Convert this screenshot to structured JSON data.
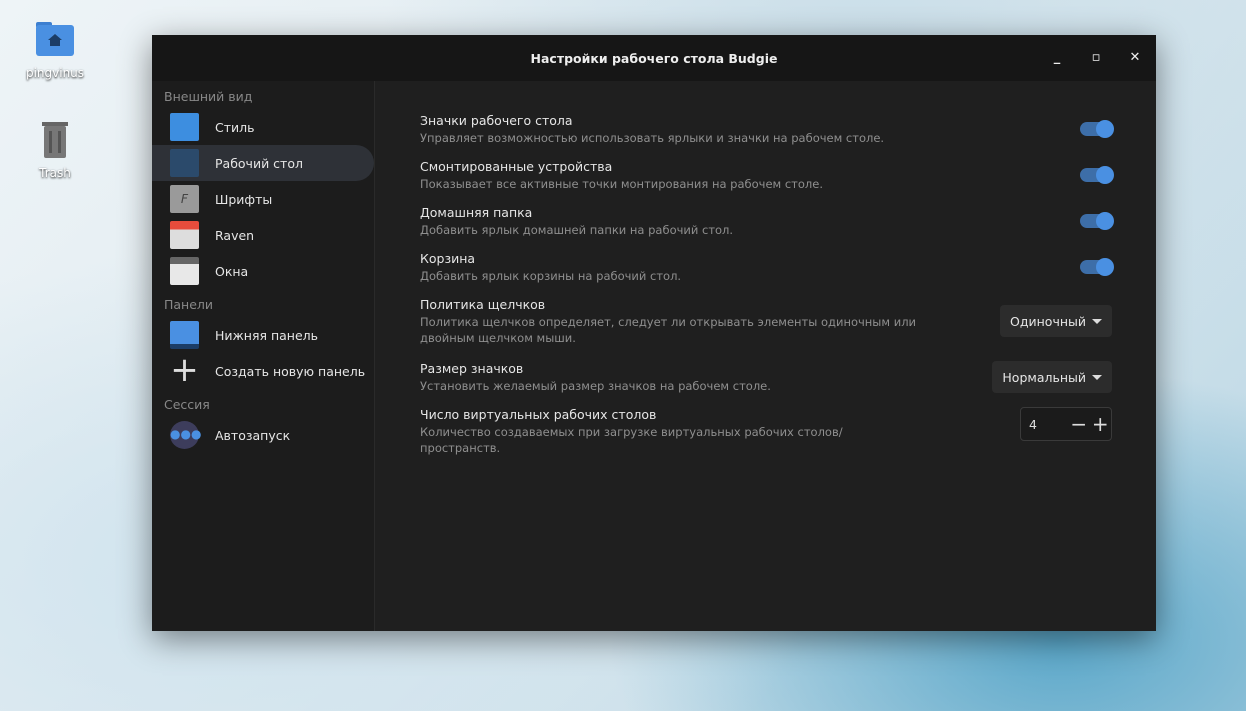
{
  "desktop": {
    "icons": [
      {
        "label": "pingvinus",
        "icon": "home-folder-icon"
      },
      {
        "label": "Trash",
        "icon": "trash-icon"
      }
    ]
  },
  "window": {
    "title": "Настройки рабочего стола Budgie"
  },
  "sidebar": {
    "sections": [
      {
        "title": "Внешний вид",
        "items": [
          {
            "label": "Стиль",
            "icon": "style-icon"
          },
          {
            "label": "Рабочий стол",
            "icon": "desktop-icon",
            "selected": true
          },
          {
            "label": "Шрифты",
            "icon": "fonts-icon"
          },
          {
            "label": "Raven",
            "icon": "calendar-icon"
          },
          {
            "label": "Окна",
            "icon": "windows-icon"
          }
        ]
      },
      {
        "title": "Панели",
        "items": [
          {
            "label": "Нижняя панель",
            "icon": "panel-icon"
          },
          {
            "label": "Создать новую панель",
            "icon": "plus-icon"
          }
        ]
      },
      {
        "title": "Сессия",
        "items": [
          {
            "label": "Автозапуск",
            "icon": "autostart-icon"
          }
        ]
      }
    ]
  },
  "settings": [
    {
      "title": "Значки рабочего стола",
      "desc": "Управляет возможностью использовать ярлыки и значки на рабочем столе.",
      "toggle": true
    },
    {
      "title": "Смонтированные устройства",
      "desc": "Показывает все активные точки монтирования на рабочем столе.",
      "toggle": true
    },
    {
      "title": "Домашняя папка",
      "desc": "Добавить ярлык домашней папки на рабочий стол.",
      "toggle": true
    },
    {
      "title": "Корзина",
      "desc": "Добавить ярлык корзины на рабочий стол.",
      "toggle": true
    },
    {
      "title": "Политика щелчков",
      "desc": "Политика щелчков определяет, следует ли открывать элементы одиночным или двойным щелчком мыши.",
      "value": "Одиночный"
    },
    {
      "title": "Размер значков",
      "desc": "Установить желаемый размер значков на рабочем столе.",
      "value": "Нормальный"
    },
    {
      "title": "Число виртуальных рабочих столов",
      "desc": "Количество создаваемых при загрузке виртуальных рабочих столов/пространств.",
      "value": "4"
    }
  ],
  "colors": {
    "accent": "#4a90e2"
  }
}
